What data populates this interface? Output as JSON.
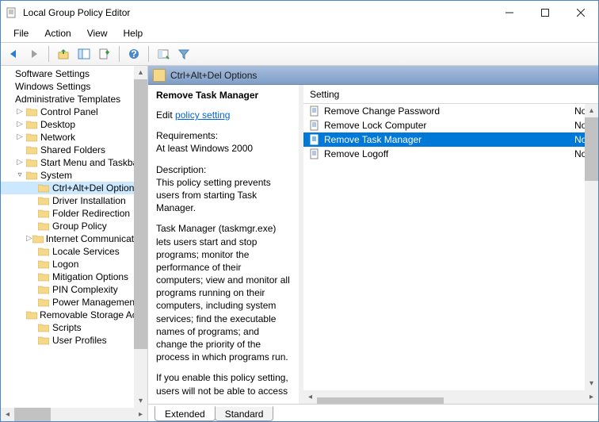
{
  "window": {
    "title": "Local Group Policy Editor"
  },
  "menubar": [
    "File",
    "Action",
    "View",
    "Help"
  ],
  "tree": {
    "roots": [
      {
        "label": "Software Settings",
        "indent": 0,
        "chev": ""
      },
      {
        "label": "Windows Settings",
        "indent": 0,
        "chev": ""
      },
      {
        "label": "Administrative Templates",
        "indent": 0,
        "chev": ""
      },
      {
        "label": "Control Panel",
        "indent": 1,
        "chev": "▷"
      },
      {
        "label": "Desktop",
        "indent": 1,
        "chev": "▷"
      },
      {
        "label": "Network",
        "indent": 1,
        "chev": "▷"
      },
      {
        "label": "Shared Folders",
        "indent": 1,
        "chev": ""
      },
      {
        "label": "Start Menu and Taskbar",
        "indent": 1,
        "chev": "▷"
      },
      {
        "label": "System",
        "indent": 1,
        "chev": "▿"
      },
      {
        "label": "Ctrl+Alt+Del Options",
        "indent": 2,
        "chev": "",
        "sel": true
      },
      {
        "label": "Driver Installation",
        "indent": 2,
        "chev": ""
      },
      {
        "label": "Folder Redirection",
        "indent": 2,
        "chev": ""
      },
      {
        "label": "Group Policy",
        "indent": 2,
        "chev": ""
      },
      {
        "label": "Internet Communication Management",
        "indent": 2,
        "chev": "▷"
      },
      {
        "label": "Locale Services",
        "indent": 2,
        "chev": ""
      },
      {
        "label": "Logon",
        "indent": 2,
        "chev": ""
      },
      {
        "label": "Mitigation Options",
        "indent": 2,
        "chev": ""
      },
      {
        "label": "PIN Complexity",
        "indent": 2,
        "chev": ""
      },
      {
        "label": "Power Management",
        "indent": 2,
        "chev": ""
      },
      {
        "label": "Removable Storage Access",
        "indent": 2,
        "chev": ""
      },
      {
        "label": "Scripts",
        "indent": 2,
        "chev": ""
      },
      {
        "label": "User Profiles",
        "indent": 2,
        "chev": ""
      }
    ]
  },
  "header": {
    "title": "Ctrl+Alt+Del Options"
  },
  "detail": {
    "name": "Remove Task Manager",
    "edit_prefix": "Edit",
    "edit_link": "policy setting",
    "req_label": "Requirements:",
    "req_value": "At least Windows 2000",
    "desc_label": "Description:",
    "desc1": "This policy setting prevents users from starting Task Manager.",
    "desc2": "Task Manager (taskmgr.exe) lets users start and stop programs; monitor the performance of their computers; view and monitor all programs running on their computers, including system services; find the executable names of programs; and change the priority of the process in which programs run.",
    "desc3": "If you enable this policy setting, users will not be able to access"
  },
  "list": {
    "header": "Setting",
    "rows": [
      {
        "label": "Remove Change Password",
        "state": "Not"
      },
      {
        "label": "Remove Lock Computer",
        "state": "Not"
      },
      {
        "label": "Remove Task Manager",
        "state": "Not",
        "sel": true
      },
      {
        "label": "Remove Logoff",
        "state": "Not"
      }
    ]
  },
  "tabs": {
    "extended": "Extended",
    "standard": "Standard"
  }
}
